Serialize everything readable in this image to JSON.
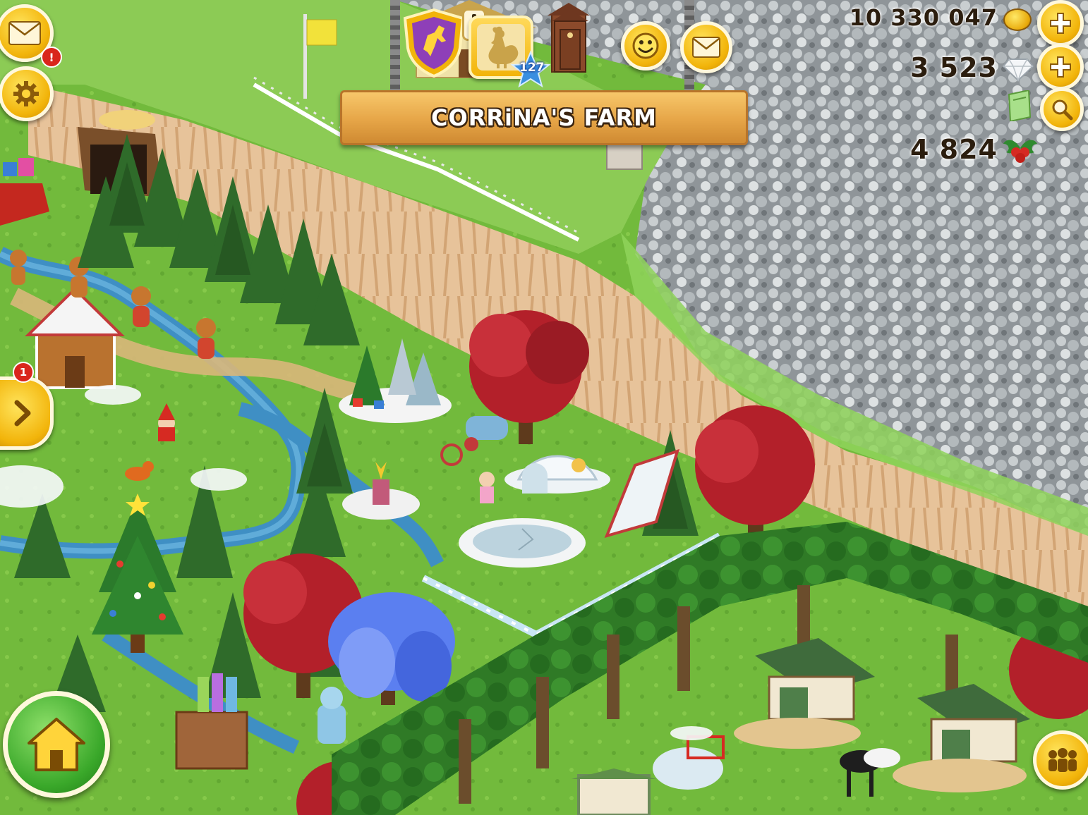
{
  "farm": {
    "name": "CORRiNA'S FARM"
  },
  "player": {
    "level": "127"
  },
  "currencies": {
    "coins": "10 330 047",
    "diamonds": "3 523",
    "event": "4 824"
  },
  "badges": {
    "mail": "!",
    "side_panel": "1"
  },
  "icons": {
    "mail": "envelope-icon",
    "settings": "gear-icon",
    "neighborhood": "goat-shield-icon",
    "alert": "exclamation-icon",
    "profile": "rooster-icon",
    "outhouse": "outhouse-icon",
    "friends_emoji": "smiley-icon",
    "top_mail": "envelope-icon",
    "add_coins": "plus-icon",
    "add_diamonds": "plus-icon",
    "vouchers": "voucher-icon",
    "search": "magnifier-icon",
    "coin": "coin-icon",
    "diamond": "diamond-icon",
    "holly": "holly-icon",
    "side_panel": "chevron-right-icon",
    "home": "house-icon",
    "friends_bar": "people-icon"
  },
  "colors": {
    "button_gold": "#f2b40a",
    "button_green": "#3aa82a",
    "badge_red": "#d9261c",
    "neighborhood_purple": "#8e3fb8",
    "sign_wood": "#e6a547",
    "grass": "#6fb93a",
    "river": "#3f8fc4",
    "frost_forest": "#9aa0a3",
    "cliff": "#e8c49a",
    "red_tree": "#b3202a",
    "pine": "#2f6b2a"
  }
}
